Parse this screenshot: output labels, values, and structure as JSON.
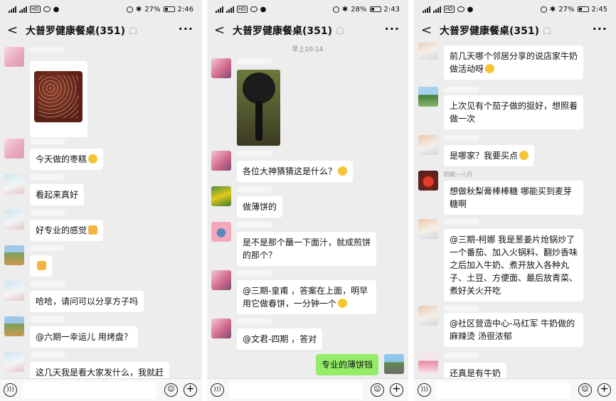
{
  "chat_title": "大普罗健康餐桌(351)",
  "more_label": "···",
  "back_label": "<",
  "icons": [
    "chevron-left-icon",
    "mute-icon",
    "more-icon",
    "voice-icon",
    "emoji-icon",
    "plus-icon",
    "signal-icon",
    "battery-icon",
    "bluetooth-icon",
    "alarm-icon"
  ],
  "panels": [
    {
      "status": {
        "battery": "27%",
        "time": "2:46"
      },
      "messages": [
        {
          "text": "今天做的枣糕"
        },
        {
          "text": "看起来真好"
        },
        {
          "text": "好专业的感觉"
        },
        {
          "text": ""
        },
        {
          "text": "哈哈，请问可以分享方子吗"
        },
        {
          "text": "@六期一幸运儿  用烤盘？"
        },
        {
          "text": "这几天我是看大家发什么，我就赶"
        }
      ]
    },
    {
      "status": {
        "battery": "28%",
        "time": "2:43"
      },
      "time_chip": "早上10:14",
      "messages": [
        {
          "text": "各位大神猜猜这是什么？"
        },
        {
          "text": "做薄饼的"
        },
        {
          "text": "是不是那个蘸一下面汁，就成煎饼的那个？"
        },
        {
          "text": "@三期-皇甫  ，答案在上面，明早用它做春饼，一分钟一个"
        },
        {
          "text": "@文君-四期  ，答对"
        },
        {
          "text": "专业的薄饼铛"
        }
      ]
    },
    {
      "status": {
        "battery": "27%",
        "time": "2:45"
      },
      "messages": [
        {
          "text": "前几天哪个邻居分享的说店家牛奶做活动呀"
        },
        {
          "text": "上次见有个茄子做的挺好，想照着做一次"
        },
        {
          "text": "是哪家？我要买点"
        },
        {
          "nick": "四期－八月",
          "text": "想做秋梨膏棒棒糖 哪能买到麦芽糖啊"
        },
        {
          "text": "@三期-柯娜   我是葱姜片炝锅炒了一个番茄、加入火锅料、翻炒香味之后加入牛奶、煮开放入各种丸子、土豆、方便面、最后放青菜、煮好关火开吃"
        },
        {
          "text": "@社区营造中心-马红军   牛奶做的麻辣烫  汤很浓郁"
        },
        {
          "text": "还真是有牛奶"
        }
      ]
    }
  ]
}
